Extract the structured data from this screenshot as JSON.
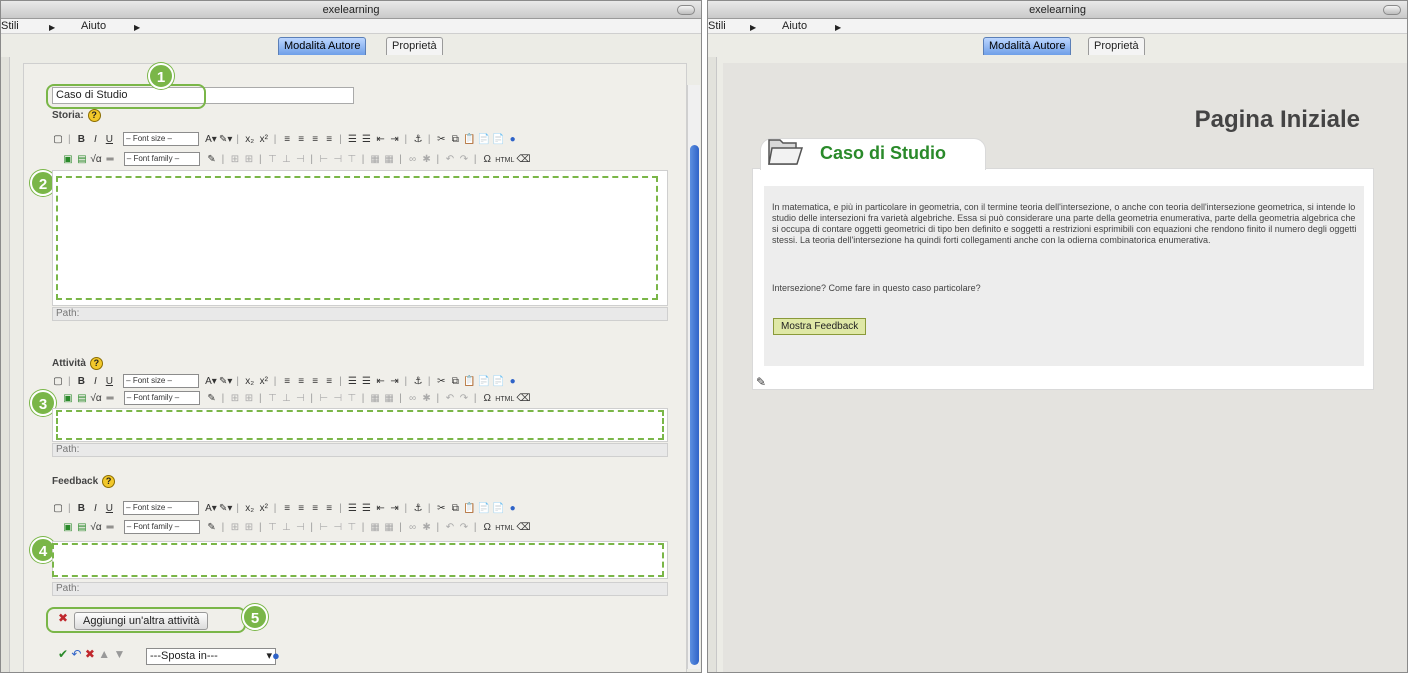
{
  "app": {
    "title": "exelearning"
  },
  "menu": {
    "item1": "Stili",
    "item2": "Aiuto"
  },
  "tabs": {
    "author": "Modalità Autore",
    "properties": "Proprietà"
  },
  "colors": {
    "accent_green": "#7ab648",
    "tab_blue": "#6f9fe8",
    "title_green": "#2a8a2a",
    "feedback_btn": "#dfe8a6"
  },
  "editor_form": {
    "title_value": "Caso di Studio",
    "storia_label": "Storia:",
    "attivita_label": "Attività",
    "feedback_label": "Feedback",
    "help_glyph": "?",
    "font_size_select": "– Font size –",
    "font_family_select": "– Font family –",
    "path_label": "Path:",
    "add_activity_button": "Aggiungi un'altra attività",
    "move_select": "---Sposta in---",
    "callouts": [
      "1",
      "2",
      "3",
      "4",
      "5"
    ]
  },
  "preview": {
    "page_title": "Pagina Iniziale",
    "card_title": "Caso di Studio",
    "paragraph": "In matematica, e più in particolare in geometria, con il termine teoria dell'intersezione, o anche con teoria dell'intersezione geometrica, si intende lo studio delle intersezioni fra varietà algebriche. Essa si può considerare una parte della geometria enumerativa, parte della geometria algebrica che si occupa di contare oggetti geometrici di tipo ben definito e soggetti a restrizioni esprimibili con equazioni che rendono finito il numero degli oggetti stessi. La teoria dell'intersezione ha quindi forti collegamenti anche con la odierna combinatorica enumerativa.",
    "question": "Intersezione? Come fare in questo caso particolare?",
    "feedback_button": "Mostra Feedback"
  },
  "icons": [
    "folder-icon",
    "edit-icon",
    "help-icon",
    "delete-icon",
    "approve-icon",
    "undo-icon",
    "up-icon",
    "down-icon",
    "info-icon"
  ]
}
